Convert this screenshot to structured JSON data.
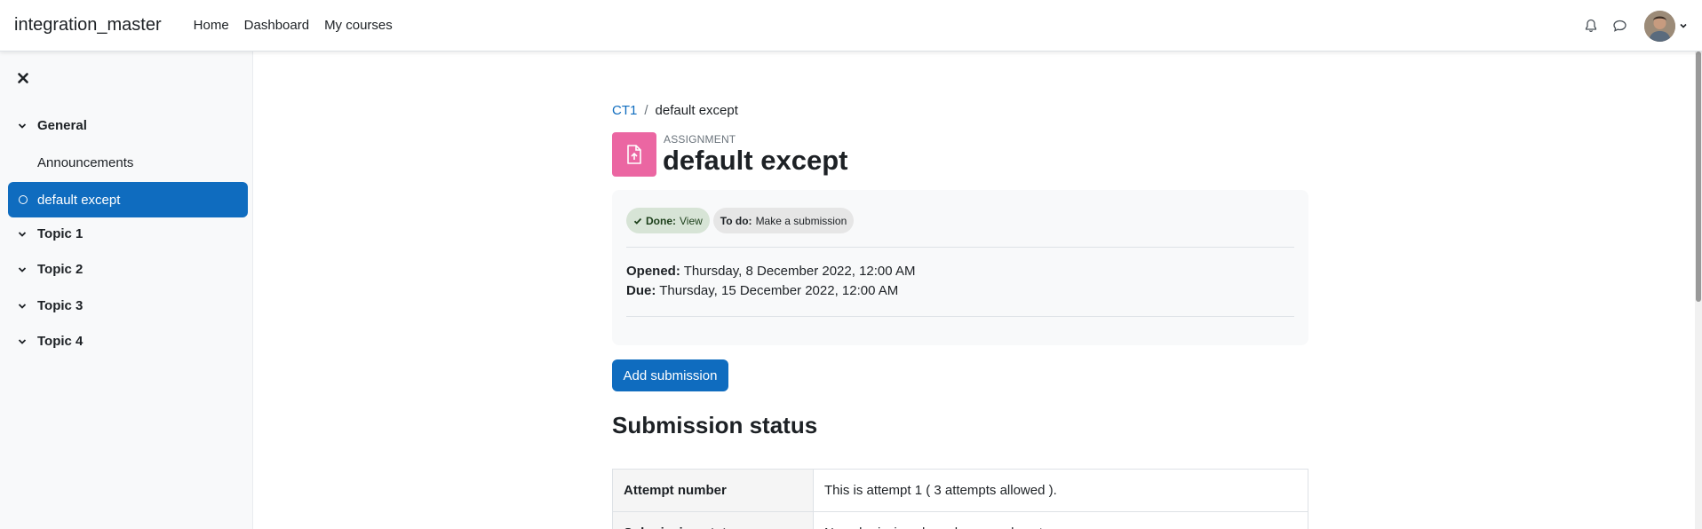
{
  "navbar": {
    "brand": "integration_master",
    "links": [
      "Home",
      "Dashboard",
      "My courses"
    ]
  },
  "drawer": {
    "sections": [
      "General",
      "Topic 1",
      "Topic 2",
      "Topic 3",
      "Topic 4"
    ],
    "items": [
      "Announcements",
      "default except"
    ]
  },
  "breadcrumb": {
    "course": "CT1",
    "sep": "/",
    "current": "default except"
  },
  "activity": {
    "type": "ASSIGNMENT",
    "title": "default except",
    "icon_color": "#eb66a2"
  },
  "completion": {
    "done_label": "Done:",
    "done_text": "View",
    "todo_label": "To do:",
    "todo_text": "Make a submission"
  },
  "dates": {
    "opened_label": "Opened:",
    "opened_value": "Thursday, 8 December 2022, 12:00 AM",
    "due_label": "Due:",
    "due_value": "Thursday, 15 December 2022, 12:00 AM"
  },
  "add_submission_label": "Add submission",
  "submission_status": {
    "heading": "Submission status",
    "rows": [
      {
        "label": "Attempt number",
        "value": "This is attempt 1 ( 3 attempts allowed )."
      },
      {
        "label": "Submission status",
        "value": "No submissions have been made yet"
      }
    ]
  },
  "colors": {
    "primary": "#0f6cbf",
    "assignment_icon": "#eb66a2"
  }
}
